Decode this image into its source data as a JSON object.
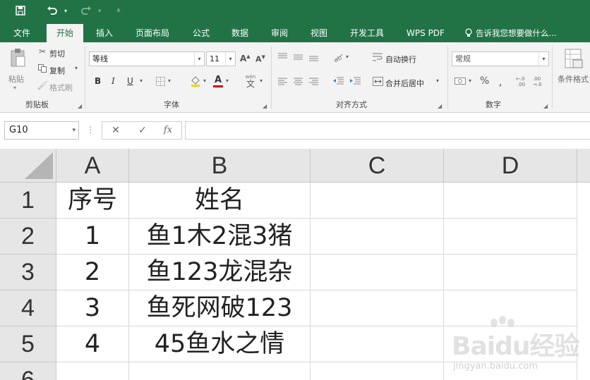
{
  "qat": {
    "save_icon": "save-icon",
    "undo_icon": "undo-icon",
    "redo_icon": "redo-icon",
    "customize_icon": "customize-icon"
  },
  "tabs": [
    {
      "label": "文件",
      "active": false
    },
    {
      "label": "开始",
      "active": true
    },
    {
      "label": "插入",
      "active": false
    },
    {
      "label": "页面布局",
      "active": false
    },
    {
      "label": "公式",
      "active": false
    },
    {
      "label": "数据",
      "active": false
    },
    {
      "label": "审阅",
      "active": false
    },
    {
      "label": "视图",
      "active": false
    },
    {
      "label": "开发工具",
      "active": false
    },
    {
      "label": "WPS PDF",
      "active": false
    }
  ],
  "tell_me": "告诉我您想要做什么...",
  "ribbon": {
    "clipboard": {
      "paste": "粘贴",
      "cut": "剪切",
      "copy": "复制",
      "format_painter": "格式刷",
      "group": "剪贴板"
    },
    "font": {
      "name": "等线",
      "size": "11",
      "bold": "B",
      "italic": "I",
      "underline": "U",
      "wen": "wén",
      "group": "字体"
    },
    "alignment": {
      "wrap": "自动换行",
      "merge": "合并后居中",
      "group": "对齐方式"
    },
    "number": {
      "format": "常规",
      "percent": "%",
      "group": "数字"
    },
    "styles": {
      "conditional": "条件格式"
    }
  },
  "formula_bar": {
    "name_box": "G10",
    "cancel": "✕",
    "enter": "✓",
    "fx": "fx",
    "value": ""
  },
  "grid": {
    "columns": [
      "A",
      "B",
      "C",
      "D"
    ],
    "rows": [
      "1",
      "2",
      "3",
      "4",
      "5",
      "6"
    ],
    "cells": [
      [
        "序号",
        "姓名",
        "",
        ""
      ],
      [
        "1",
        "鱼1木2混3猪",
        "",
        ""
      ],
      [
        "2",
        "鱼123龙混杂",
        "",
        ""
      ],
      [
        "3",
        "鱼死网破123",
        "",
        ""
      ],
      [
        "4",
        "45鱼水之情",
        "",
        ""
      ],
      [
        "",
        "",
        "",
        ""
      ]
    ]
  },
  "watermark": {
    "logo": "Baidu经验",
    "url": "jingyan.baidu.com"
  },
  "colors": {
    "brand": "#217346",
    "ribbon_bg": "#f3f3f3",
    "header_bg": "#e6e6e6"
  }
}
